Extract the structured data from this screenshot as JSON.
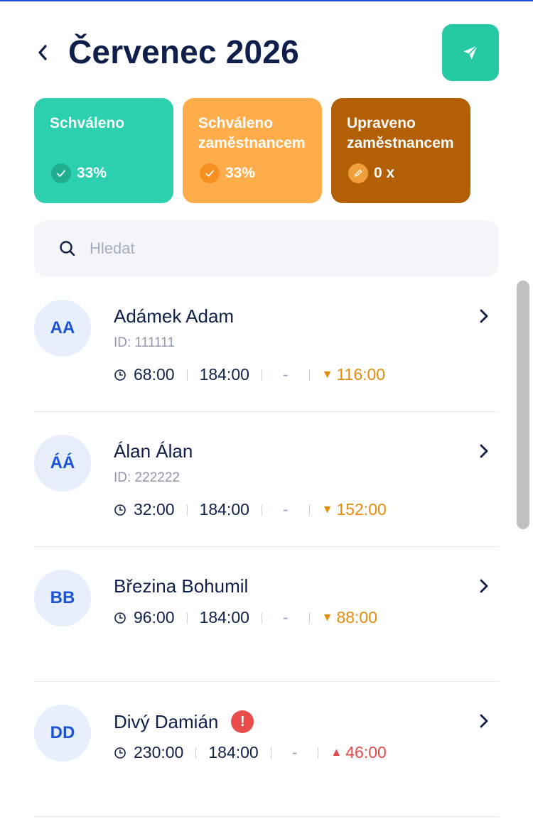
{
  "header": {
    "title": "Červenec 2026"
  },
  "cards": [
    {
      "title_line1": "Schváleno",
      "title_line2": "",
      "value": "33%",
      "icon": "check-icon"
    },
    {
      "title_line1": "Schváleno",
      "title_line2": "zaměstnancem",
      "value": "33%",
      "icon": "check-icon"
    },
    {
      "title_line1": "Upraveno",
      "title_line2": "zaměstnancem",
      "value": "0 x",
      "icon": "pencil-icon"
    }
  ],
  "search": {
    "placeholder": "Hledat",
    "value": ""
  },
  "employees": [
    {
      "initials": "AA",
      "name": "Adámek Adam",
      "id_text": "ID: 111111",
      "worked": "68:00",
      "planned": "184:00",
      "extra": "-",
      "diff": "116:00",
      "diff_dir": "down",
      "alert": false
    },
    {
      "initials": "ÁÁ",
      "name": "Álan Álan",
      "id_text": "ID: 222222",
      "worked": "32:00",
      "planned": "184:00",
      "extra": "-",
      "diff": "152:00",
      "diff_dir": "down",
      "alert": false
    },
    {
      "initials": "BB",
      "name": "Březina Bohumil",
      "id_text": "",
      "worked": "96:00",
      "planned": "184:00",
      "extra": "-",
      "diff": "88:00",
      "diff_dir": "down",
      "alert": false
    },
    {
      "initials": "DD",
      "name": "Divý Damián",
      "id_text": "",
      "worked": "230:00",
      "planned": "184:00",
      "extra": "-",
      "diff": "46:00",
      "diff_dir": "up",
      "alert": true,
      "alert_symbol": "!"
    }
  ],
  "colors": {
    "approved": "#2ccfae",
    "approved_by_employee": "#ffad4a",
    "edited_by_employee": "#b35f05",
    "accent": "#25c9a4",
    "diff_down": "#e58a0a",
    "diff_up": "#e14848"
  }
}
